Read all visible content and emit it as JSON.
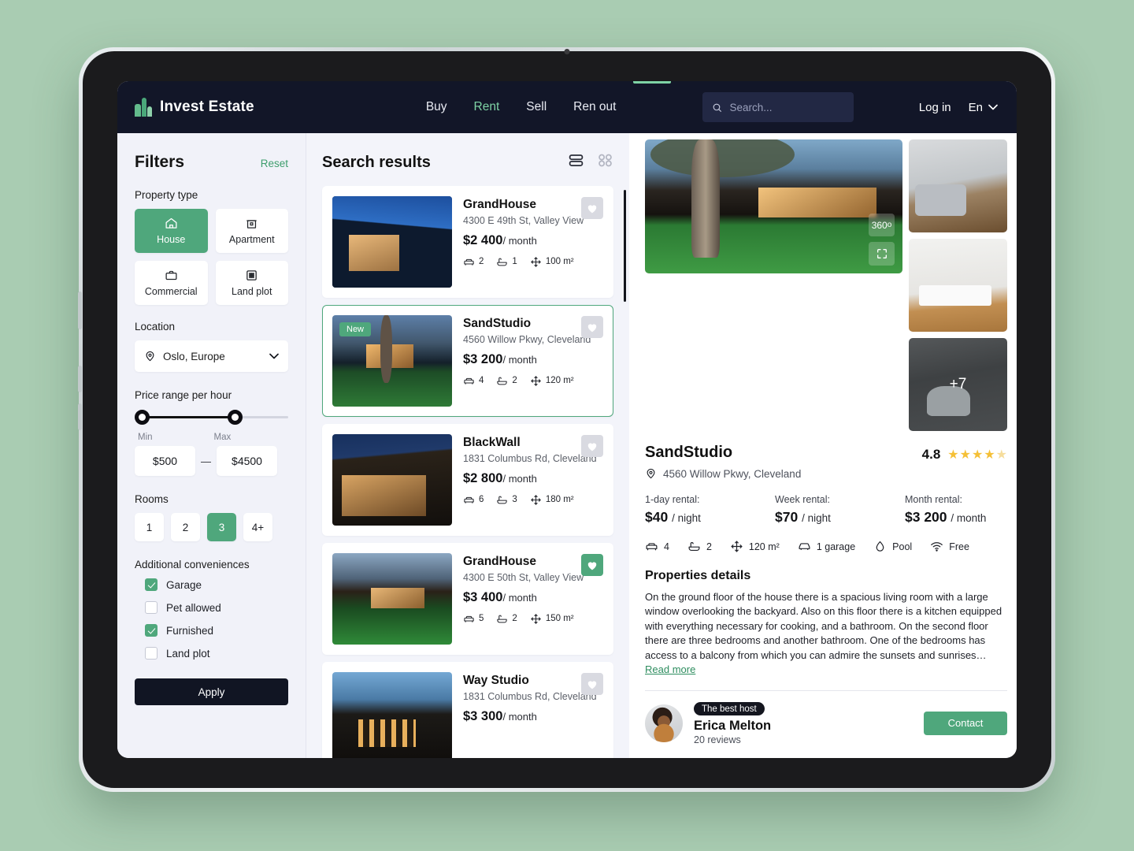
{
  "nav": {
    "brand": "Invest Estate",
    "links": [
      {
        "label": "Buy",
        "active": false
      },
      {
        "label": "Rent",
        "active": true
      },
      {
        "label": "Sell",
        "active": false
      },
      {
        "label": "Ren out",
        "active": false
      }
    ],
    "search_placeholder": "Search...",
    "search_value": "",
    "login_label": "Log in",
    "language": "En"
  },
  "filters": {
    "title": "Filters",
    "reset_label": "Reset",
    "property_type_label": "Property type",
    "property_types": [
      {
        "label": "House",
        "icon": "home-icon",
        "selected": true
      },
      {
        "label": "Apartment",
        "icon": "apartment-icon",
        "selected": false
      },
      {
        "label": "Commercial",
        "icon": "briefcase-icon",
        "selected": false
      },
      {
        "label": "Land plot",
        "icon": "grid-dots-icon",
        "selected": false
      }
    ],
    "location_label": "Location",
    "location_value": "Oslo, Europe",
    "price_label": "Price range per hour",
    "min_label": "Min",
    "max_label": "Max",
    "min_value": "$500",
    "max_value": "$4500",
    "rooms_label": "Rooms",
    "rooms": [
      {
        "label": "1",
        "selected": false
      },
      {
        "label": "2",
        "selected": false
      },
      {
        "label": "3",
        "selected": true
      },
      {
        "label": "4+",
        "selected": false
      }
    ],
    "conveniences_label": "Additional conveniences",
    "conveniences": [
      {
        "label": "Garage",
        "checked": true
      },
      {
        "label": "Pet allowed",
        "checked": false
      },
      {
        "label": "Furnished",
        "checked": true
      },
      {
        "label": "Land plot",
        "checked": false
      }
    ],
    "apply_label": "Apply"
  },
  "results": {
    "title": "Search results",
    "view_list_active": true,
    "view_grid_active": false,
    "cards": [
      {
        "title": "GrandHouse",
        "address": "4300 E 49th St, Valley View",
        "price": "$2 400",
        "price_unit": "/ month",
        "beds": "2",
        "baths": "1",
        "area": "100 m²",
        "badge": "",
        "favorite": false,
        "selected": false,
        "photo": "ph-house1"
      },
      {
        "title": "SandStudio",
        "address": "4560 Willow Pkwy, Cleveland",
        "price": "$3 200",
        "price_unit": "/ month",
        "beds": "4",
        "baths": "2",
        "area": "120 m²",
        "badge": "New",
        "favorite": false,
        "selected": true,
        "photo": "ph-sand"
      },
      {
        "title": "BlackWall",
        "address": "1831 Columbus Rd, Cleveland",
        "price": "$2 800",
        "price_unit": "/ month",
        "beds": "6",
        "baths": "3",
        "area": "180 m²",
        "badge": "",
        "favorite": false,
        "selected": false,
        "photo": "ph-black"
      },
      {
        "title": "GrandHouse",
        "address": "4300 E 50th St, Valley View",
        "price": "$3 400",
        "price_unit": "/ month",
        "beds": "5",
        "baths": "2",
        "area": "150 m²",
        "badge": "",
        "favorite": true,
        "selected": false,
        "photo": "ph-grand2"
      },
      {
        "title": "Way Studio",
        "address": "1831 Columbus Rd, Cleveland",
        "price": "$3 300",
        "price_unit": "/ month",
        "beds": "",
        "baths": "",
        "area": "",
        "badge": "",
        "favorite": false,
        "selected": false,
        "photo": "ph-way"
      }
    ]
  },
  "detail": {
    "gallery": {
      "hero_360_label": "360",
      "hero_expand_icon": "expand-icon",
      "thumbs": [
        {
          "photo": "ph-living",
          "more": ""
        },
        {
          "photo": "ph-kitchen",
          "more": ""
        },
        {
          "photo": "ph-bath",
          "more": "+7"
        }
      ]
    },
    "title": "SandStudio",
    "address": "4560 Willow Pkwy, Cleveland",
    "rating_value": "4.8",
    "rating_stars": 4.5,
    "rentals": [
      {
        "label": "1-day rental:",
        "price": "$40",
        "unit": "/ night"
      },
      {
        "label": "Week rental:",
        "price": "$70",
        "unit": "/ night"
      },
      {
        "label": "Month rental:",
        "price": "$3 200",
        "unit": "/ month"
      }
    ],
    "amenities": [
      {
        "label": "4",
        "icon": "bed-icon"
      },
      {
        "label": "2",
        "icon": "bath-icon"
      },
      {
        "label": "120 m²",
        "icon": "area-icon"
      },
      {
        "label": "1 garage",
        "icon": "car-icon"
      },
      {
        "label": "Pool",
        "icon": "water-drop-icon"
      },
      {
        "label": "Free",
        "icon": "wifi-icon"
      }
    ],
    "details_title": "Properties details",
    "details_text": "On the ground floor of the house there is a spacious living room with a large window overlooking the backyard. Also on this floor there is a kitchen equipped with everything necessary for cooking, and a bathroom.\nOn the second floor there are three bedrooms and another bathroom. One of the bedrooms has access to a balcony from which you can admire the sunsets and sunrises… ",
    "read_more_label": "Read more",
    "host": {
      "badge": "The best host",
      "name": "Erica Melton",
      "reviews": "20 reviews",
      "contact_label": "Contact"
    }
  },
  "colors": {
    "brand_green": "#4fa77c",
    "nav_dark": "#121628",
    "page_bg": "#a9ccb2",
    "accent_star": "#f5c037"
  }
}
